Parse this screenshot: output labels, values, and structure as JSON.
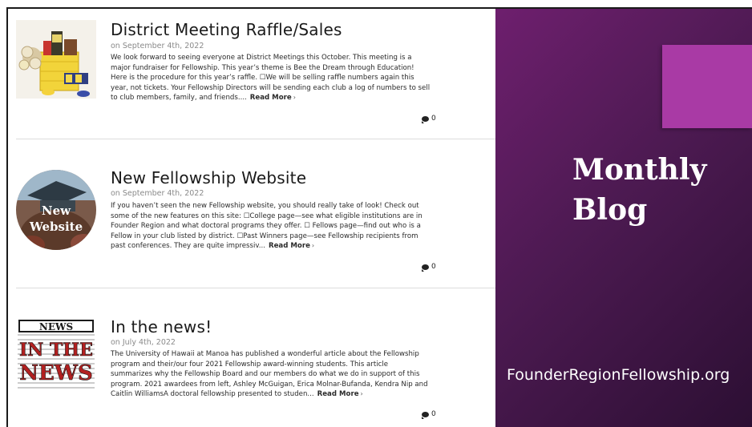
{
  "posts": [
    {
      "title": "District Meeting Raffle/Sales",
      "date": "on September 4th, 2022",
      "excerpt": "We look forward to seeing everyone at District Meetings this October. This meeting is a major fundraiser for Fellowship. This year’s theme is Bee the Dream through Education! Here is the procedure for this year’s raffle. ☐We will be selling raffle numbers again this year, not tickets. Your Fellowship Directors will be sending each club a log of numbers to sell to club members, family, and friends....",
      "read_more": "Read More",
      "comments": "0",
      "thumb": "gift-basket"
    },
    {
      "title": "New Fellowship Website",
      "date": "on September 4th, 2022",
      "excerpt": "If you haven’t seen the new Fellowship website, you should really take of look! Check out some of the new features on this site: ☐College page—see what eligible institutions are in Founder Region and what doctoral programs they offer. ☐ Fellows page—find out who is a Fellow in your club listed by district. ☐Past Winners page—see Fellowship recipients from past conferences. They are quite impressiv...",
      "read_more": "Read More",
      "comments": "0",
      "thumb_text_1": "New",
      "thumb_text_2": "Website"
    },
    {
      "title": "In the news!",
      "date": "on July 4th, 2022",
      "excerpt": "The University of Hawaii at Manoa has published a wonderful article about the Fellowship program and their/our four 2021 Fellowship award-winning students. This article summarizes why the Fellowship Board and our members do what we do in support of this program.  2021 awardees from left, Ashley McGuigan, Erica Molnar-Bufanda, Kendra Nip and Caitlin WilliamsA doctoral fellowship presented to studen...",
      "read_more": "Read More",
      "comments": "0",
      "thumb_text_1": "NEWS",
      "thumb_text_2": "IN THE",
      "thumb_text_3": "NEWS"
    }
  ],
  "panel": {
    "heading": "Monthly Blog",
    "url": "FounderRegionFellowship.org"
  },
  "colors": {
    "panel_dark": "#2c0f33",
    "panel_mid": "#6e1f6e",
    "accent": "#a93aa5"
  }
}
